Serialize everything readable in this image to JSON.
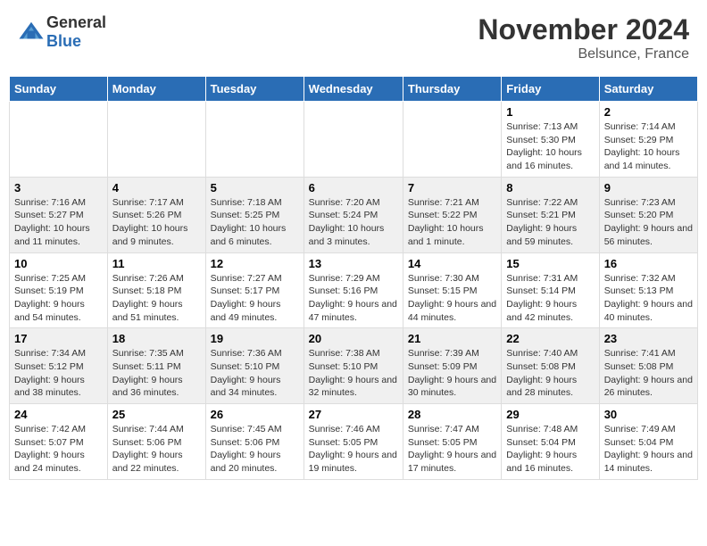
{
  "header": {
    "logo_general": "General",
    "logo_blue": "Blue",
    "month_title": "November 2024",
    "location": "Belsunce, France"
  },
  "days_of_week": [
    "Sunday",
    "Monday",
    "Tuesday",
    "Wednesday",
    "Thursday",
    "Friday",
    "Saturday"
  ],
  "weeks": [
    {
      "days": [
        {
          "number": "",
          "info": ""
        },
        {
          "number": "",
          "info": ""
        },
        {
          "number": "",
          "info": ""
        },
        {
          "number": "",
          "info": ""
        },
        {
          "number": "",
          "info": ""
        },
        {
          "number": "1",
          "info": "Sunrise: 7:13 AM\nSunset: 5:30 PM\nDaylight: 10 hours and 16 minutes."
        },
        {
          "number": "2",
          "info": "Sunrise: 7:14 AM\nSunset: 5:29 PM\nDaylight: 10 hours and 14 minutes."
        }
      ]
    },
    {
      "days": [
        {
          "number": "3",
          "info": "Sunrise: 7:16 AM\nSunset: 5:27 PM\nDaylight: 10 hours and 11 minutes."
        },
        {
          "number": "4",
          "info": "Sunrise: 7:17 AM\nSunset: 5:26 PM\nDaylight: 10 hours and 9 minutes."
        },
        {
          "number": "5",
          "info": "Sunrise: 7:18 AM\nSunset: 5:25 PM\nDaylight: 10 hours and 6 minutes."
        },
        {
          "number": "6",
          "info": "Sunrise: 7:20 AM\nSunset: 5:24 PM\nDaylight: 10 hours and 3 minutes."
        },
        {
          "number": "7",
          "info": "Sunrise: 7:21 AM\nSunset: 5:22 PM\nDaylight: 10 hours and 1 minute."
        },
        {
          "number": "8",
          "info": "Sunrise: 7:22 AM\nSunset: 5:21 PM\nDaylight: 9 hours and 59 minutes."
        },
        {
          "number": "9",
          "info": "Sunrise: 7:23 AM\nSunset: 5:20 PM\nDaylight: 9 hours and 56 minutes."
        }
      ]
    },
    {
      "days": [
        {
          "number": "10",
          "info": "Sunrise: 7:25 AM\nSunset: 5:19 PM\nDaylight: 9 hours and 54 minutes."
        },
        {
          "number": "11",
          "info": "Sunrise: 7:26 AM\nSunset: 5:18 PM\nDaylight: 9 hours and 51 minutes."
        },
        {
          "number": "12",
          "info": "Sunrise: 7:27 AM\nSunset: 5:17 PM\nDaylight: 9 hours and 49 minutes."
        },
        {
          "number": "13",
          "info": "Sunrise: 7:29 AM\nSunset: 5:16 PM\nDaylight: 9 hours and 47 minutes."
        },
        {
          "number": "14",
          "info": "Sunrise: 7:30 AM\nSunset: 5:15 PM\nDaylight: 9 hours and 44 minutes."
        },
        {
          "number": "15",
          "info": "Sunrise: 7:31 AM\nSunset: 5:14 PM\nDaylight: 9 hours and 42 minutes."
        },
        {
          "number": "16",
          "info": "Sunrise: 7:32 AM\nSunset: 5:13 PM\nDaylight: 9 hours and 40 minutes."
        }
      ]
    },
    {
      "days": [
        {
          "number": "17",
          "info": "Sunrise: 7:34 AM\nSunset: 5:12 PM\nDaylight: 9 hours and 38 minutes."
        },
        {
          "number": "18",
          "info": "Sunrise: 7:35 AM\nSunset: 5:11 PM\nDaylight: 9 hours and 36 minutes."
        },
        {
          "number": "19",
          "info": "Sunrise: 7:36 AM\nSunset: 5:10 PM\nDaylight: 9 hours and 34 minutes."
        },
        {
          "number": "20",
          "info": "Sunrise: 7:38 AM\nSunset: 5:10 PM\nDaylight: 9 hours and 32 minutes."
        },
        {
          "number": "21",
          "info": "Sunrise: 7:39 AM\nSunset: 5:09 PM\nDaylight: 9 hours and 30 minutes."
        },
        {
          "number": "22",
          "info": "Sunrise: 7:40 AM\nSunset: 5:08 PM\nDaylight: 9 hours and 28 minutes."
        },
        {
          "number": "23",
          "info": "Sunrise: 7:41 AM\nSunset: 5:08 PM\nDaylight: 9 hours and 26 minutes."
        }
      ]
    },
    {
      "days": [
        {
          "number": "24",
          "info": "Sunrise: 7:42 AM\nSunset: 5:07 PM\nDaylight: 9 hours and 24 minutes."
        },
        {
          "number": "25",
          "info": "Sunrise: 7:44 AM\nSunset: 5:06 PM\nDaylight: 9 hours and 22 minutes."
        },
        {
          "number": "26",
          "info": "Sunrise: 7:45 AM\nSunset: 5:06 PM\nDaylight: 9 hours and 20 minutes."
        },
        {
          "number": "27",
          "info": "Sunrise: 7:46 AM\nSunset: 5:05 PM\nDaylight: 9 hours and 19 minutes."
        },
        {
          "number": "28",
          "info": "Sunrise: 7:47 AM\nSunset: 5:05 PM\nDaylight: 9 hours and 17 minutes."
        },
        {
          "number": "29",
          "info": "Sunrise: 7:48 AM\nSunset: 5:04 PM\nDaylight: 9 hours and 16 minutes."
        },
        {
          "number": "30",
          "info": "Sunrise: 7:49 AM\nSunset: 5:04 PM\nDaylight: 9 hours and 14 minutes."
        }
      ]
    }
  ]
}
